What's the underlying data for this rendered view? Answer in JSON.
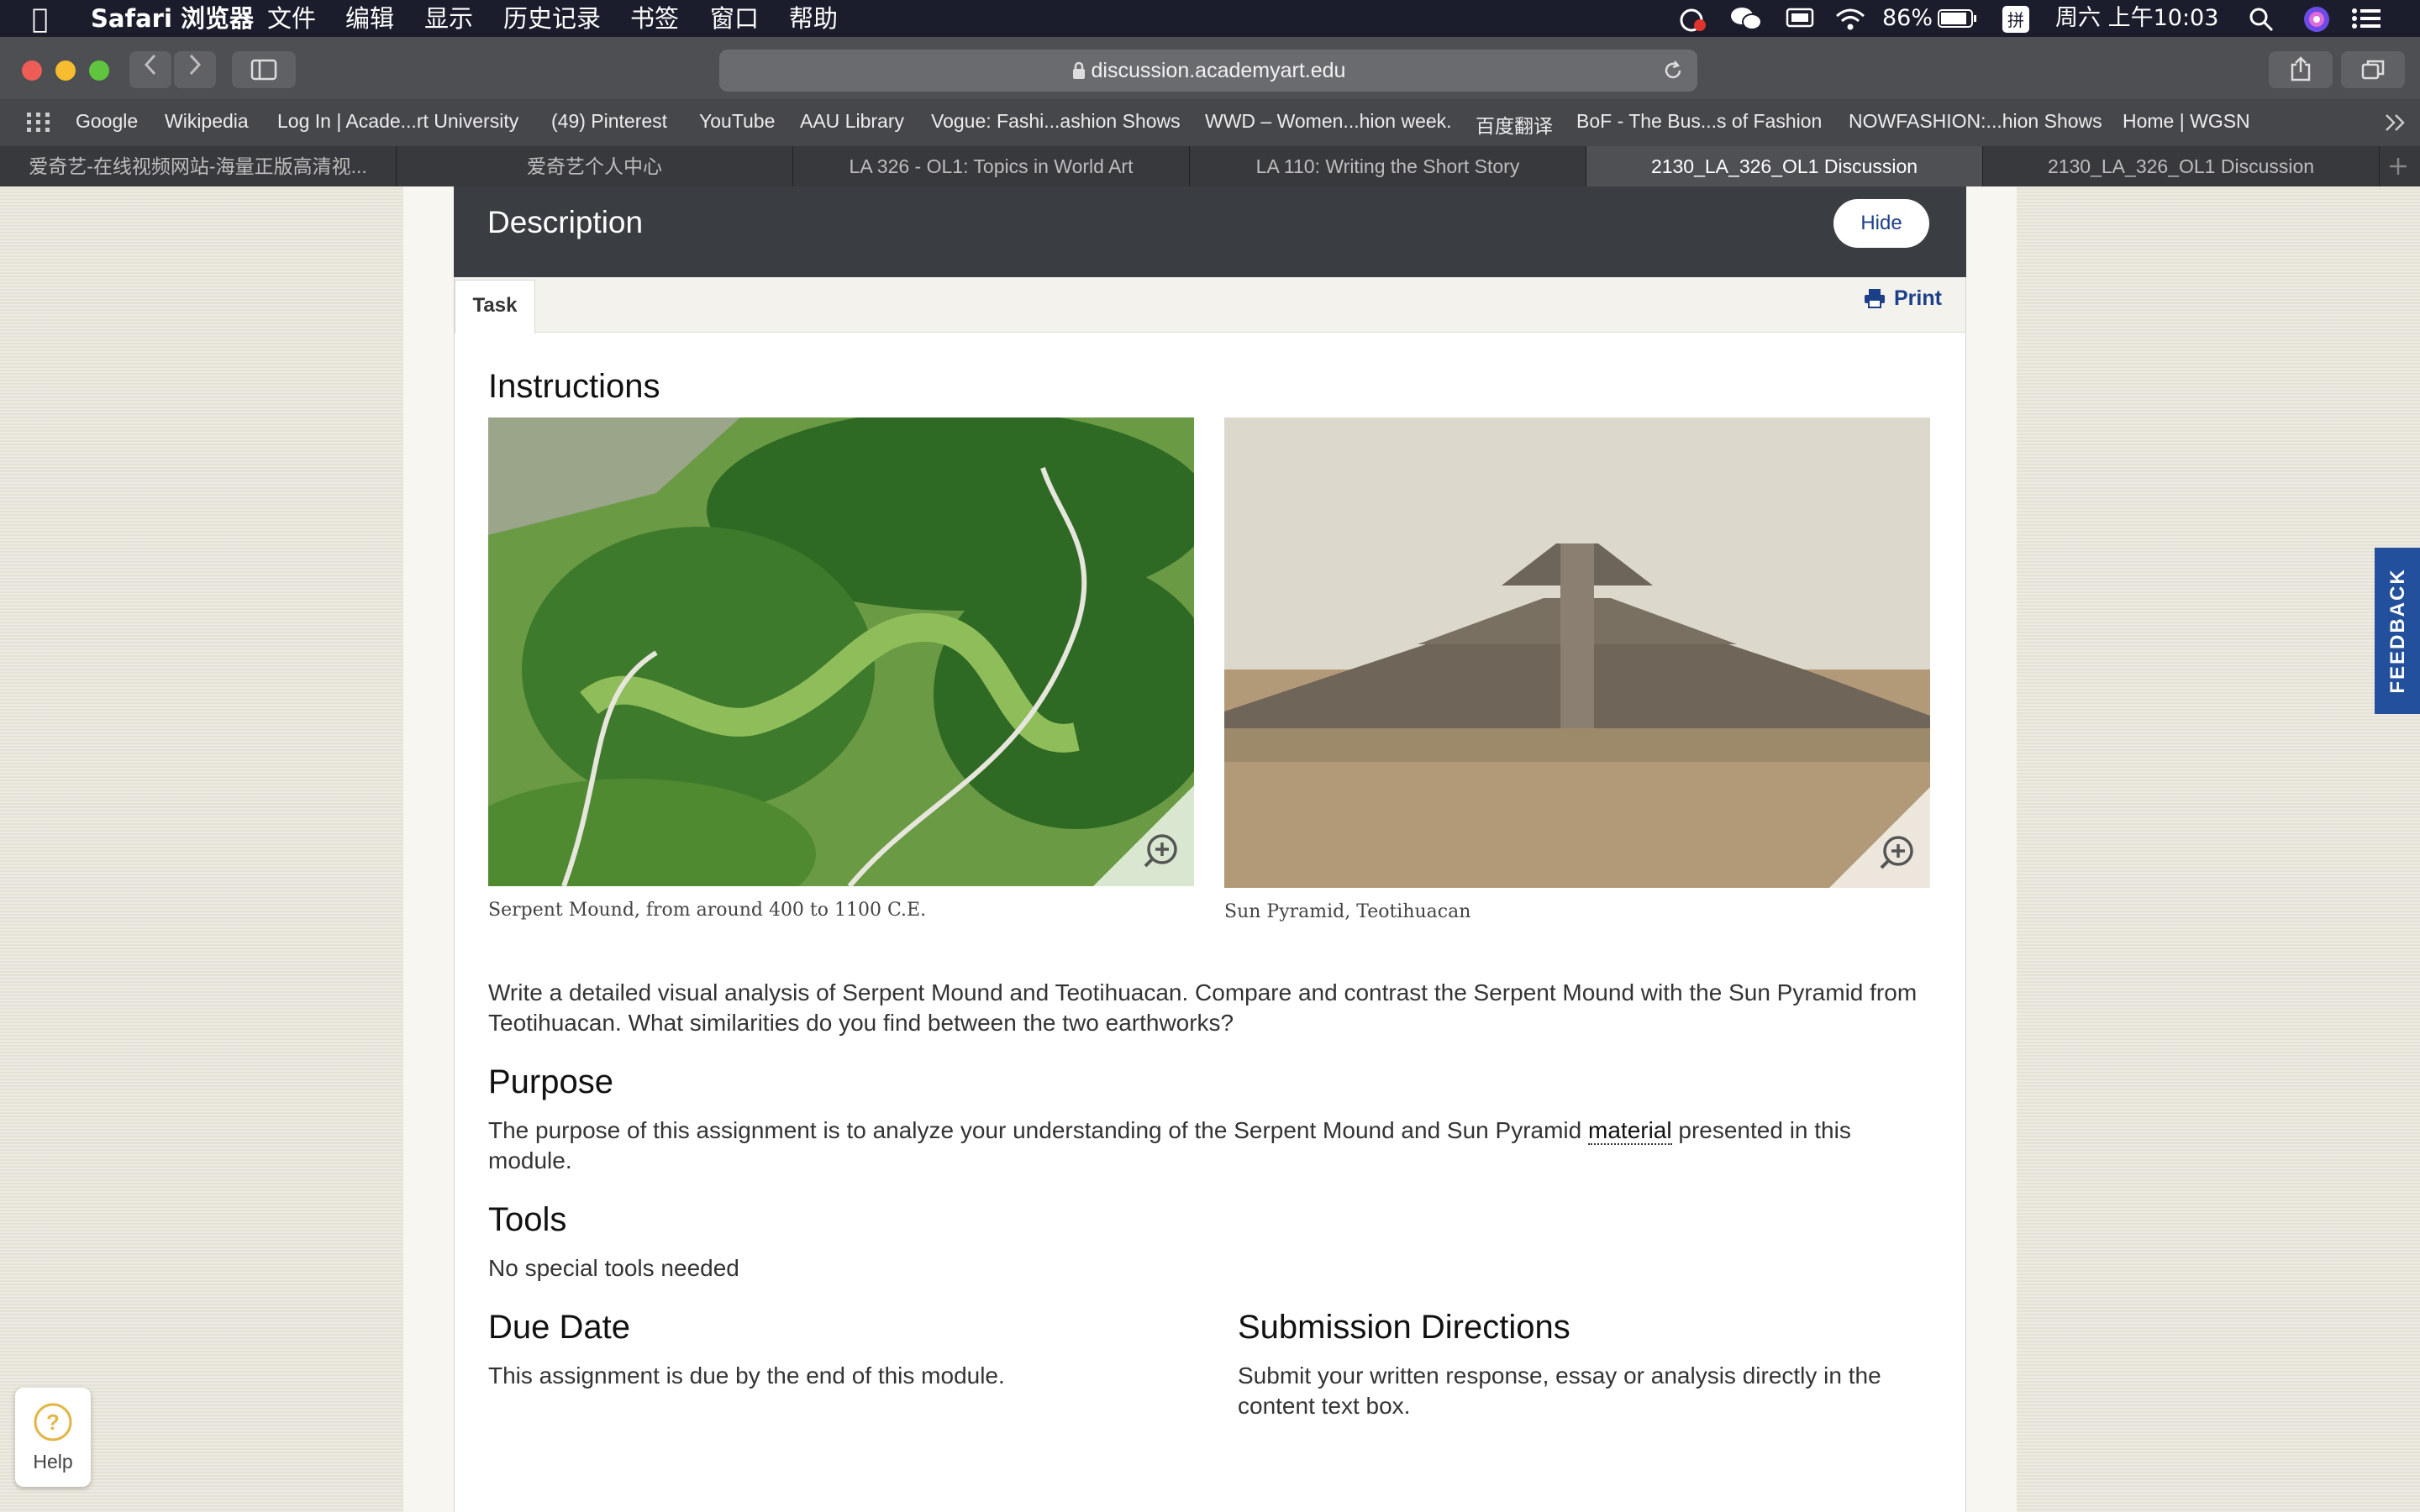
{
  "menubar": {
    "app": "Safari 浏览器",
    "menus": [
      "文件",
      "编辑",
      "显示",
      "历史记录",
      "书签",
      "窗口",
      "帮助"
    ],
    "battery": "86%",
    "clock": "周六 上午10:03"
  },
  "toolbar": {
    "url": "discussion.academyart.edu"
  },
  "bookmarks": [
    "Google",
    "Wikipedia",
    "Log In | Acade...rt University",
    "(49) Pinterest",
    "YouTube",
    "AAU Library",
    "Vogue: Fashi...ashion Shows",
    "WWD – Women...hion week.",
    "百度翻译",
    "BoF - The Bus...s of Fashion",
    "NOWFASHION:...hion Shows",
    "Home | WGSN"
  ],
  "tabs": [
    {
      "label": "爱奇艺-在线视频网站-海量正版高清视..."
    },
    {
      "label": "爱奇艺个人中心"
    },
    {
      "label": "LA 326 - OL1: Topics in World Art"
    },
    {
      "label": "LA 110: Writing the Short Story"
    },
    {
      "label": "2130_LA_326_OL1 Discussion",
      "active": true
    },
    {
      "label": "2130_LA_326_OL1 Discussion"
    }
  ],
  "panel": {
    "title": "Description",
    "hide_label": "Hide",
    "task_tab": "Task",
    "print_label": "Print"
  },
  "content": {
    "instructions_heading": "Instructions",
    "image1_caption": "Serpent Mound, from around 400 to 1100 C.E.",
    "image2_caption": "Sun Pyramid, Teotihuacan",
    "prompt_line1": "Write a detailed visual analysis of Serpent Mound and Teotihuacan. Compare and contrast the Serpent Mound with the Sun Pyramid from",
    "prompt_line2": "Teotihuacan. What similarities do you find between the two earthworks?",
    "purpose_heading": "Purpose",
    "purpose_line1_a": "The purpose of this assignment is to analyze your understanding of the Serpent Mound and Sun Pyramid",
    "purpose_link": "material",
    "purpose_line1_b": "presented in this",
    "purpose_line2": "module.",
    "tools_heading": "Tools",
    "tools_text": "No special tools needed",
    "due_heading": "Due Date",
    "due_text": "This assignment is due by the end of this module.",
    "submission_heading": "Submission Directions",
    "submission_line1": "Submit your written response, essay or analysis directly in the",
    "submission_line2": "content text box."
  },
  "feedback_label": "FEEDBACK",
  "help_label": "Help"
}
